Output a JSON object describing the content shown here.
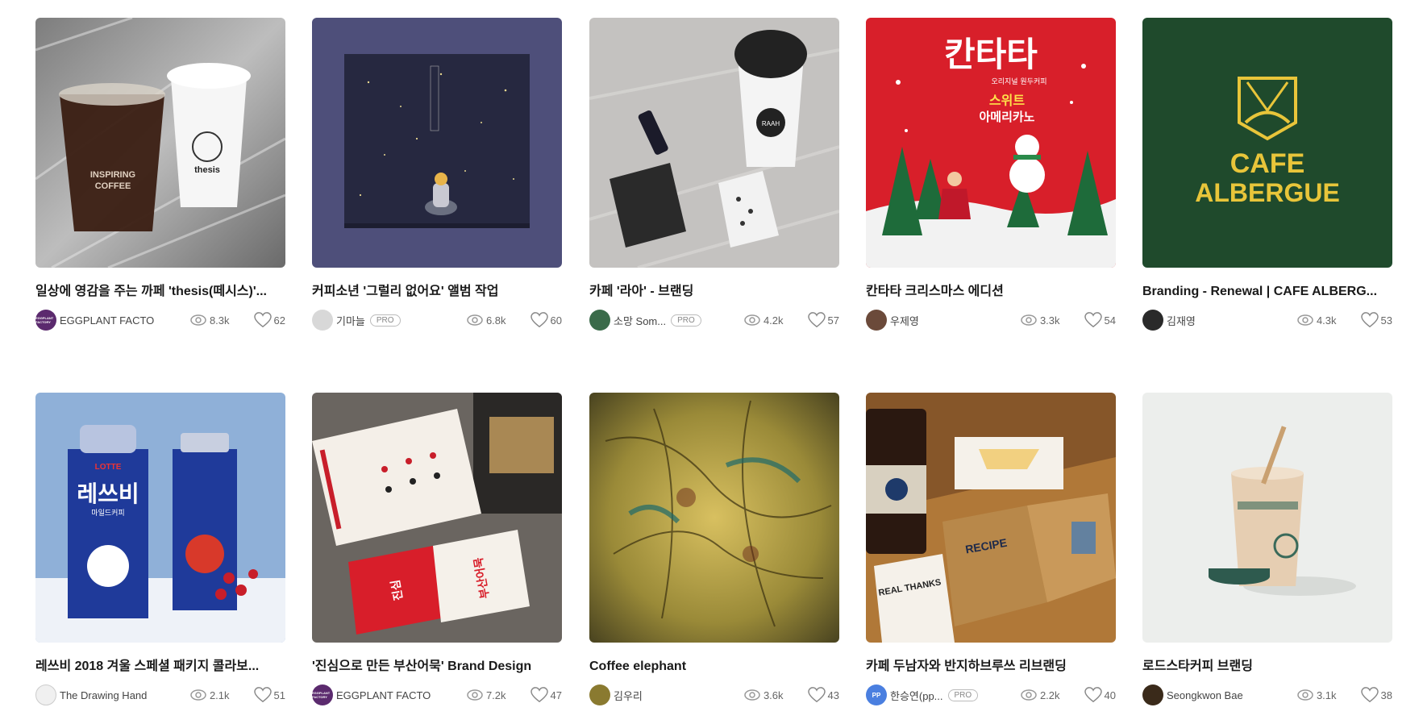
{
  "cards": [
    {
      "title": "일상에 영감을 주는 까페 'thesis(떼시스)'...",
      "author": "EGGPLANT FACTO",
      "pro": "",
      "views": "8.3k",
      "likes": "62",
      "avatar_color": "#5b2a6e",
      "avatar_text": "EGGPLANT FACTORY",
      "thumb_text": [
        "INSPIRING",
        "COFFEE",
        "thesis"
      ]
    },
    {
      "title": "커피소년 '그럴리 없어요' 앨범 작업",
      "author": "기마늘",
      "pro": "PRO",
      "views": "6.8k",
      "likes": "60",
      "avatar_color": "#d8d8d8",
      "avatar_text": "",
      "thumb_text": []
    },
    {
      "title": "카페 '라아' - 브랜딩",
      "author": "소망 Som...",
      "pro": "PRO",
      "views": "4.2k",
      "likes": "57",
      "avatar_color": "#3a6b4a",
      "avatar_text": "",
      "thumb_text": [
        "RAAH"
      ]
    },
    {
      "title": "칸타타 크리스마스 에디션",
      "author": "우제영",
      "pro": "",
      "views": "3.3k",
      "likes": "54",
      "avatar_color": "#6b4a3a",
      "avatar_text": "",
      "thumb_text": [
        "칸타타",
        "오리지널 원두커피",
        "스위트",
        "아메리카노"
      ]
    },
    {
      "title": "Branding - Renewal  |  CAFE ALBERG...",
      "author": "김재영",
      "pro": "",
      "views": "4.3k",
      "likes": "53",
      "avatar_color": "#2a2a2a",
      "avatar_text": "",
      "thumb_text": [
        "CAFE",
        "ALBERGUE"
      ]
    },
    {
      "title": "레쓰비 2018 겨울 스페셜 패키지 콜라보...",
      "author": "The Drawing Hand",
      "pro": "",
      "views": "2.1k",
      "likes": "51",
      "avatar_color": "#f0f0f0",
      "avatar_text": "",
      "thumb_text": [
        "LOTTE",
        "레쓰비",
        "마일드커피"
      ]
    },
    {
      "title": "'진심으로 만든 부산어묵' Brand Design",
      "author": "EGGPLANT FACTO",
      "pro": "",
      "views": "7.2k",
      "likes": "47",
      "avatar_color": "#5b2a6e",
      "avatar_text": "EGGPLANT FACTORY",
      "thumb_text": [
        "진심",
        "부산어묵"
      ]
    },
    {
      "title": "Coffee elephant",
      "author": "김우리",
      "pro": "",
      "views": "3.6k",
      "likes": "43",
      "avatar_color": "#8a7a30",
      "avatar_text": "",
      "thumb_text": []
    },
    {
      "title": "카페 두남자와 반지하브루쓰 리브랜딩",
      "author": "한승연(pp...",
      "pro": "PRO",
      "views": "2.2k",
      "likes": "40",
      "avatar_color": "#4a7fe0",
      "avatar_text": "PP",
      "thumb_text": [
        "RECIPE",
        "REAL THANKS"
      ]
    },
    {
      "title": "로드스타커피 브랜딩",
      "author": "Seongkwon Bae",
      "pro": "",
      "views": "3.1k",
      "likes": "38",
      "avatar_color": "#3a2a1a",
      "avatar_text": "",
      "thumb_text": []
    }
  ],
  "icons": {
    "views": "eye-icon",
    "likes": "heart-icon"
  }
}
